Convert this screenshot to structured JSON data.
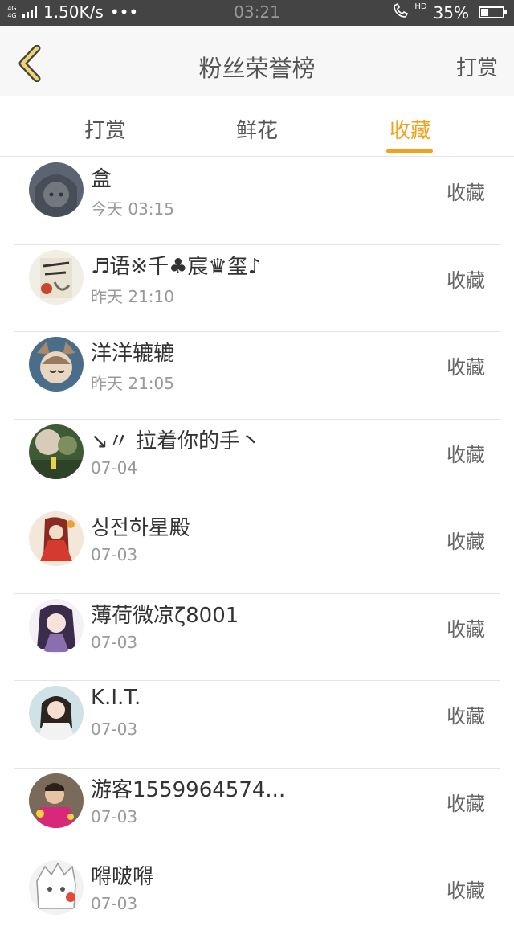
{
  "status_bar": {
    "network_tag": "4G 4G",
    "speed": "1.50K/s",
    "dots": "•••",
    "time": "03:21",
    "hd": "HD",
    "battery_text": "35%",
    "battery_level": 0.35
  },
  "nav": {
    "title": "粉丝荣誉榜",
    "right_action": "打赏"
  },
  "tabs": [
    {
      "label": "打赏",
      "active": false
    },
    {
      "label": "鲜花",
      "active": false
    },
    {
      "label": "收藏",
      "active": true
    }
  ],
  "colors": {
    "accent": "#f2a218",
    "status_bar_bg": "#444444"
  },
  "list": [
    {
      "name": "盒",
      "time": "今天 03:15",
      "action": "收藏"
    },
    {
      "name": "♬语※千♣宸♛玺♪",
      "time": "昨天 21:10",
      "action": "收藏"
    },
    {
      "name": "洋洋辘辘",
      "time": "昨天 21:05",
      "action": "收藏"
    },
    {
      "name": "↘〃 拉着你的手丶",
      "time": "07-04",
      "action": "收藏"
    },
    {
      "name": "싱전하星殿",
      "time": "07-03",
      "action": "收藏"
    },
    {
      "name": "薄荷微凉ζ8001",
      "time": "07-03",
      "action": "收藏"
    },
    {
      "name": "K.I.T.",
      "time": "07-03",
      "action": "收藏"
    },
    {
      "name": "游客1559964574...",
      "time": "07-03",
      "action": "收藏"
    },
    {
      "name": "嘚啵嘚",
      "time": "07-03",
      "action": "收藏"
    }
  ]
}
